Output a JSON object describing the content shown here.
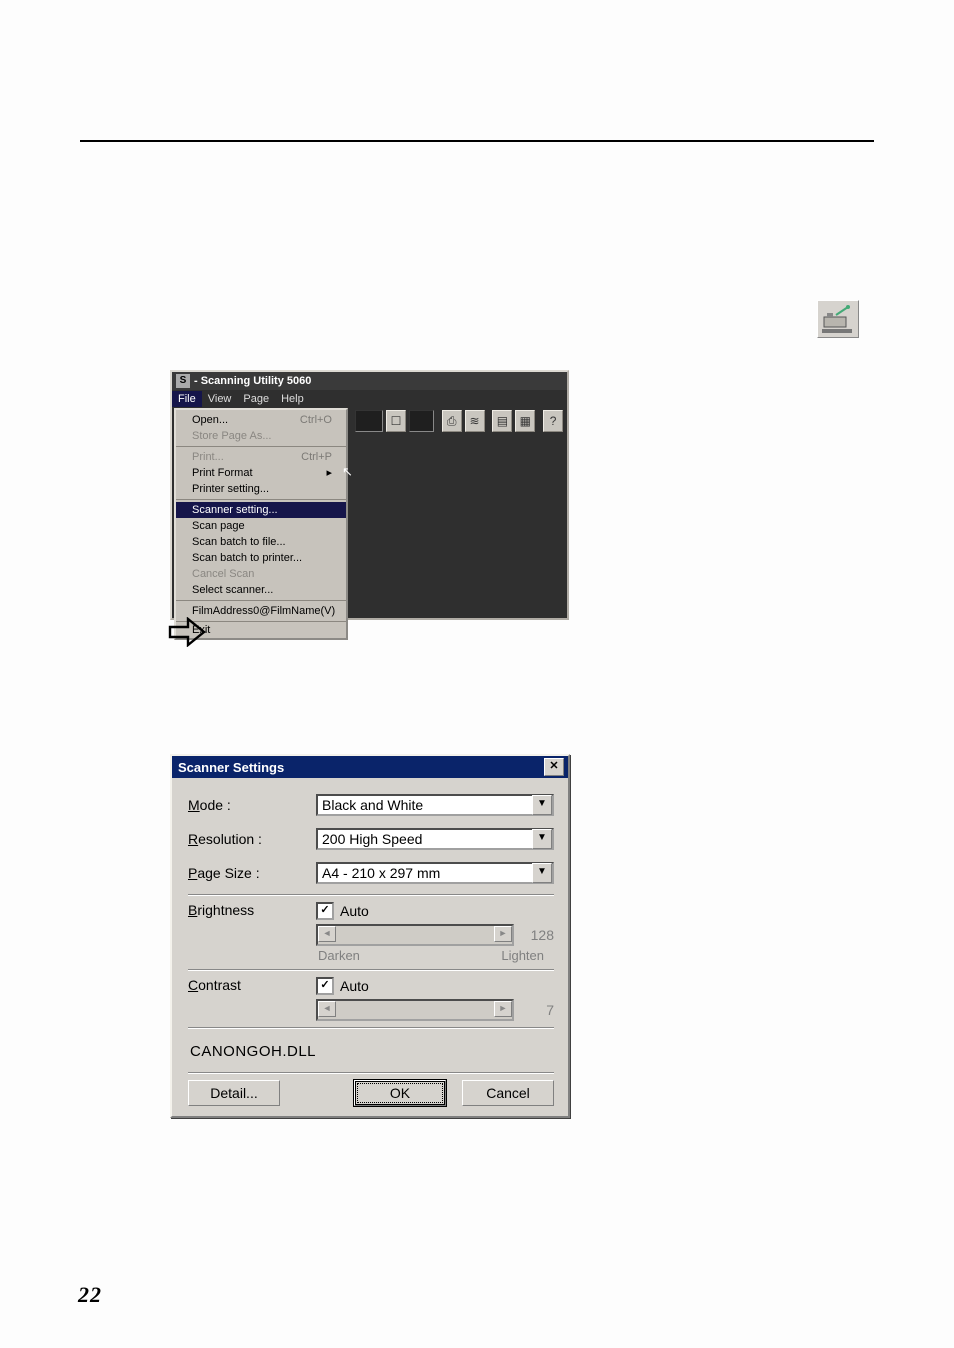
{
  "page_number": "22",
  "menu_window": {
    "title": "- Scanning Utility 5060",
    "menubar": [
      "File",
      "View",
      "Page",
      "Help"
    ],
    "open_menu": "File",
    "sections": [
      [
        {
          "label": "Open...",
          "shortcut": "Ctrl+O",
          "disabled": false
        },
        {
          "label": "Store Page As...",
          "shortcut": "",
          "disabled": true
        }
      ],
      [
        {
          "label": "Print...",
          "shortcut": "Ctrl+P",
          "disabled": true
        },
        {
          "label": "Print Format",
          "shortcut": "▸",
          "disabled": false
        },
        {
          "label": "Printer setting...",
          "shortcut": "",
          "disabled": false
        }
      ],
      [
        {
          "label": "Scanner setting...",
          "shortcut": "",
          "disabled": false,
          "highlight": true
        },
        {
          "label": "Scan page",
          "shortcut": "",
          "disabled": false
        },
        {
          "label": "Scan batch to file...",
          "shortcut": "",
          "disabled": false
        },
        {
          "label": "Scan batch to printer...",
          "shortcut": "",
          "disabled": false
        },
        {
          "label": "Cancel Scan",
          "shortcut": "",
          "disabled": true
        },
        {
          "label": "Select scanner...",
          "shortcut": "",
          "disabled": false
        }
      ],
      [
        {
          "label": "FilmAddress0@FilmName(V)",
          "shortcut": "",
          "disabled": false
        }
      ],
      [
        {
          "label": "Exit",
          "shortcut": "",
          "disabled": false
        }
      ]
    ]
  },
  "dialog": {
    "title": "Scanner Settings",
    "mode": {
      "label": "Mode :",
      "value": "Black and White"
    },
    "resolution": {
      "label": "Resolution :",
      "value": "200 High Speed"
    },
    "page_size": {
      "label": "Page Size :",
      "value": "A4 - 210 x 297 mm"
    },
    "brightness": {
      "label": "Brightness",
      "auto_label": "Auto",
      "auto_checked": true,
      "value": "128",
      "dark_label": "Darken",
      "light_label": "Lighten"
    },
    "contrast": {
      "label": "Contrast",
      "auto_label": "Auto",
      "auto_checked": true,
      "value": "7"
    },
    "dll_name": "CANONGOH.DLL",
    "buttons": {
      "detail": "Detail...",
      "ok": "OK",
      "cancel": "Cancel"
    }
  }
}
